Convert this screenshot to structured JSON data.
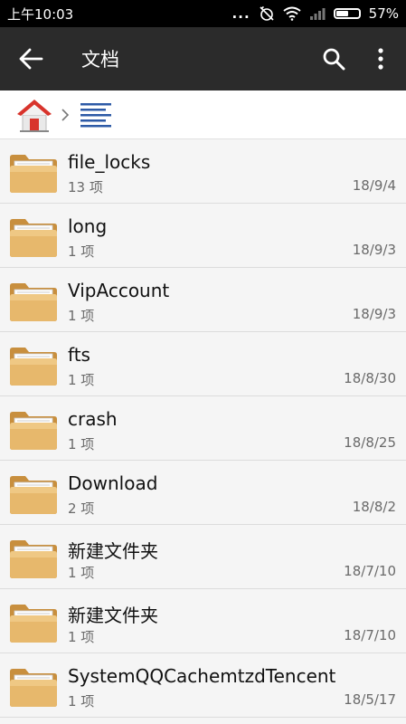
{
  "status": {
    "time": "上午10:03",
    "dots": "...",
    "battery": "57%",
    "battery_level": 0.57
  },
  "toolbar": {
    "title": "文档",
    "back_icon": "arrow-left-icon",
    "search_icon": "search-icon",
    "more_icon": "more-vert-icon"
  },
  "breadcrumb": {
    "home_icon": "home-icon",
    "current_icon": "documents-icon"
  },
  "files": [
    {
      "name": "file_locks",
      "count": "13 项",
      "date": "18/9/4"
    },
    {
      "name": "long",
      "count": "1 项",
      "date": "18/9/3"
    },
    {
      "name": "VipAccount",
      "count": "1 项",
      "date": "18/9/3"
    },
    {
      "name": "fts",
      "count": "1 项",
      "date": "18/8/30"
    },
    {
      "name": "crash",
      "count": "1 项",
      "date": "18/8/25"
    },
    {
      "name": "Download",
      "count": "2 项",
      "date": "18/8/2"
    },
    {
      "name": "新建文件夹",
      "count": "1 项",
      "date": "18/7/10"
    },
    {
      "name": "新建文件夹",
      "count": "1 项",
      "date": "18/7/10"
    },
    {
      "name": "SystemQQCachemtzdTencent",
      "count": "1 项",
      "date": "18/5/17"
    }
  ],
  "colors": {
    "toolbar": "#2b2b2b",
    "statusbar": "#000000",
    "folder": "#e7b86c",
    "accent_blue": "#2d5aa6",
    "home_red": "#d8342c"
  }
}
